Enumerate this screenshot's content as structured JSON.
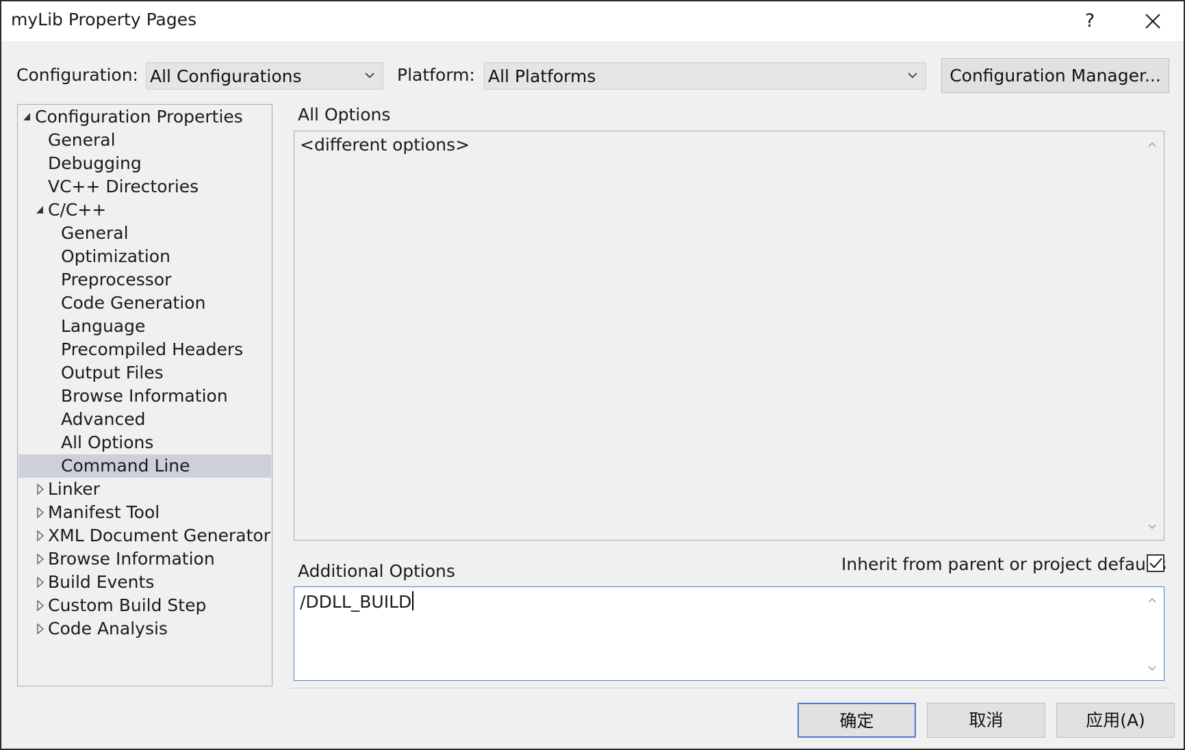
{
  "window": {
    "title": "myLib Property Pages",
    "help_label": "?",
    "close_icon": "close-icon"
  },
  "config_row": {
    "configuration_label": "Configuration:",
    "configuration_value": "All Configurations",
    "platform_label": "Platform:",
    "platform_value": "All Platforms",
    "config_manager_label": "Configuration Manager..."
  },
  "tree": {
    "items": [
      {
        "label": "Configuration Properties",
        "level": 0,
        "expander": "expanded"
      },
      {
        "label": "General",
        "level": 1,
        "expander": "none"
      },
      {
        "label": "Debugging",
        "level": 1,
        "expander": "none"
      },
      {
        "label": "VC++ Directories",
        "level": 1,
        "expander": "none"
      },
      {
        "label": "C/C++",
        "level": 1,
        "expander": "expanded"
      },
      {
        "label": "General",
        "level": 2,
        "expander": "none"
      },
      {
        "label": "Optimization",
        "level": 2,
        "expander": "none"
      },
      {
        "label": "Preprocessor",
        "level": 2,
        "expander": "none"
      },
      {
        "label": "Code Generation",
        "level": 2,
        "expander": "none"
      },
      {
        "label": "Language",
        "level": 2,
        "expander": "none"
      },
      {
        "label": "Precompiled Headers",
        "level": 2,
        "expander": "none"
      },
      {
        "label": "Output Files",
        "level": 2,
        "expander": "none"
      },
      {
        "label": "Browse Information",
        "level": 2,
        "expander": "none"
      },
      {
        "label": "Advanced",
        "level": 2,
        "expander": "none"
      },
      {
        "label": "All Options",
        "level": 2,
        "expander": "none"
      },
      {
        "label": "Command Line",
        "level": 2,
        "expander": "none",
        "selected": true
      },
      {
        "label": "Linker",
        "level": 1,
        "expander": "collapsed"
      },
      {
        "label": "Manifest Tool",
        "level": 1,
        "expander": "collapsed"
      },
      {
        "label": "XML Document Generator",
        "level": 1,
        "expander": "collapsed"
      },
      {
        "label": "Browse Information",
        "level": 1,
        "expander": "collapsed"
      },
      {
        "label": "Build Events",
        "level": 1,
        "expander": "collapsed"
      },
      {
        "label": "Custom Build Step",
        "level": 1,
        "expander": "collapsed"
      },
      {
        "label": "Code Analysis",
        "level": 1,
        "expander": "collapsed"
      }
    ]
  },
  "all_options": {
    "label": "All Options",
    "value": "<different options>"
  },
  "additional_options": {
    "label": "Additional Options",
    "value": "/DDLL_BUILD",
    "inherit_label": "Inherit from parent or project defaults",
    "inherit_checked": true
  },
  "footer": {
    "ok_label": "确定",
    "cancel_label": "取消",
    "apply_label": "应用(A)"
  },
  "colors": {
    "accent": "#4a7bd0",
    "selection": "#cdd0da",
    "dialog_bg": "#f0f0f0"
  }
}
